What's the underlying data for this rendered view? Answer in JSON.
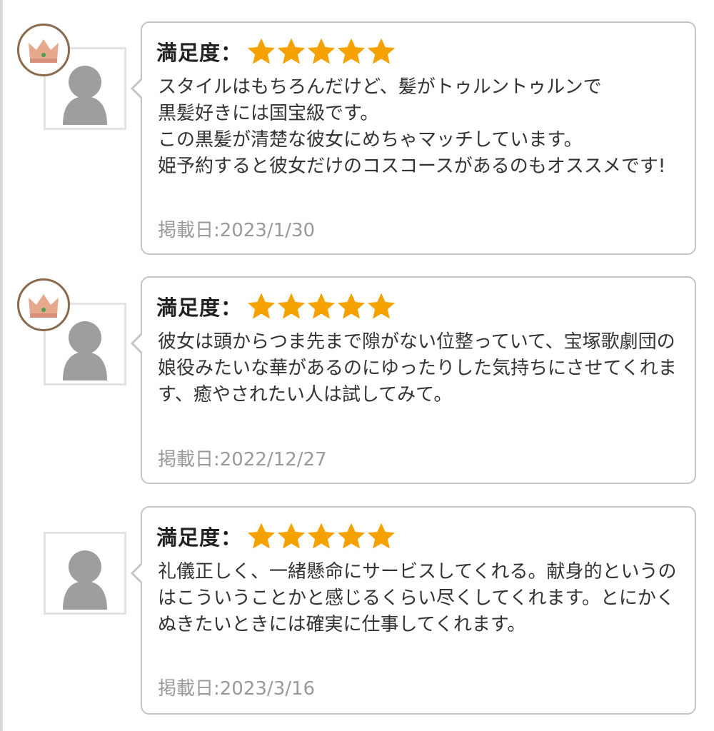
{
  "colors": {
    "star": "#f5a100",
    "border": "#c4c4c4",
    "date": "#9a9a9a",
    "text": "#333333"
  },
  "reviews": [
    {
      "badge": "crown-icon",
      "rating_label": "満足度：",
      "stars": 5,
      "comment": "スタイルはもちろんだけど、髪がトゥルントゥルンで\n黒髪好きには国宝級です。\nこの黒髪が清楚な彼女にめちゃマッチしています。\n姫予約すると彼女だけのコスコースがあるのもオススメです!",
      "date": "掲載日:2023/1/30"
    },
    {
      "badge": "crown-icon",
      "rating_label": "満足度：",
      "stars": 5,
      "comment": "彼女は頭からつま先まで隙がない位整っていて、宝塚歌劇団の娘役みたいな華があるのにゆったりした気持ちにさせてくれます、癒やされたい人は試してみて。",
      "date": "掲載日:2022/12/27"
    },
    {
      "badge": null,
      "rating_label": "満足度：",
      "stars": 5,
      "comment": "礼儀正しく、一緒懸命にサービスしてくれる。献身的というのはこういうことかと感じるくらい尽くしてくれます。とにかくぬきたいときには確実に仕事してくれます。",
      "date": "掲載日:2023/3/16"
    }
  ]
}
